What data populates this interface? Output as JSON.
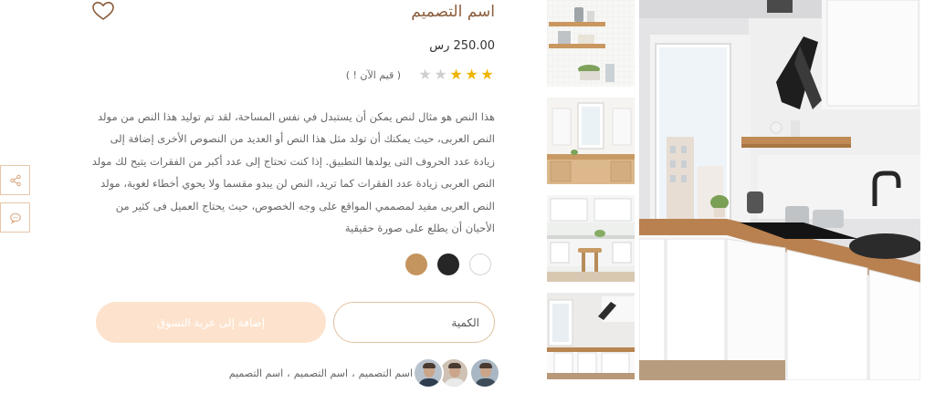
{
  "product": {
    "title": "اسم التصميم",
    "price": "250.00 رس",
    "rating": {
      "value": 3,
      "max": 5,
      "label": "( قيم الآن ! )"
    },
    "description": "هذا النص هو مثال لنص يمكن أن يستبدل في نفس المساحة، لقد تم توليد هذا النص من مولد النص العربى، حيث يمكنك أن تولد مثل هذا النص أو العديد من النصوص الأخرى إضافة إلى زيادة عدد الحروف التى يولدها التطبيق. إذا كنت تحتاج إلى عدد أكبر من الفقرات يتيح لك مولد النص العربى زيادة عدد الفقرات كما تريد، النص لن يبدو مقسما ولا يحوي أخطاء لغوية، مولد النص العربى مفيد لمصممي المواقع على وجه الخصوص، حيث يحتاج العميل فى كثير من الأحيان أن يطلع على صورة حقيقية",
    "colors": [
      "#c4955e",
      "#262626",
      "#ffffff"
    ],
    "quantity_placeholder": "الكمية",
    "add_to_cart_label": "إضافة إلى عربة التسوق",
    "designers": [
      "اسم التصميم",
      "اسم التصميم",
      "اسم التصميم"
    ]
  },
  "icons": {
    "favorite": "heart-icon",
    "share": "share-icon",
    "chat": "chat-icon"
  },
  "theme": {
    "accent": "#8a5c3b",
    "border": "#e3c2a3",
    "cart_button": "#fde3cd",
    "star": "#f0b400"
  }
}
